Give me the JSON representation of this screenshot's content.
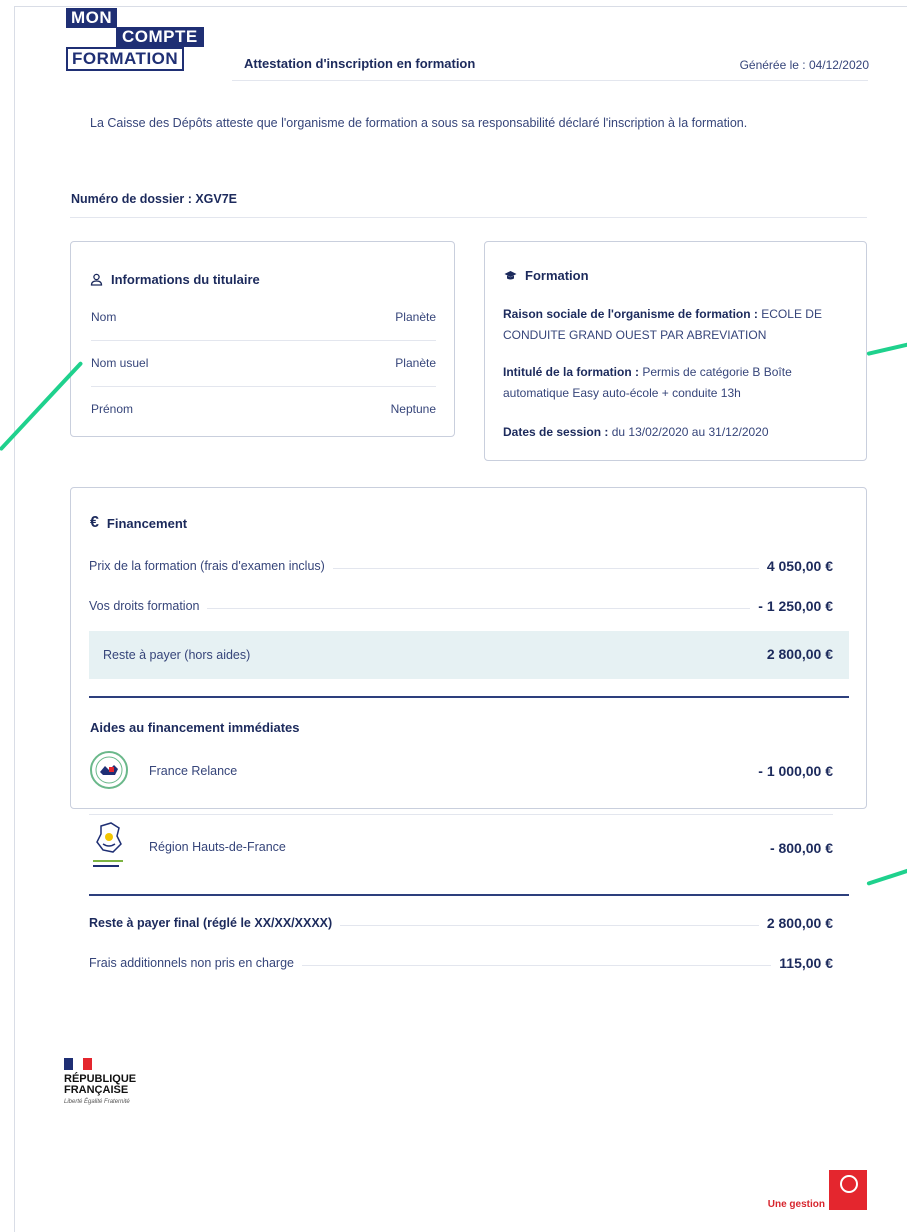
{
  "header": {
    "logo": {
      "line1": "MON",
      "line2": "COMPTE",
      "line3": "FORMATION"
    },
    "title": "Attestation d'inscription en formation",
    "generated": "Générée le : 04/12/2020"
  },
  "intro": "La Caisse des Dépôts atteste que l'organisme de formation a sous sa responsabilité déclaré l'inscription à la formation.",
  "dossier": "Numéro de dossier : XGV7E",
  "titulaire": {
    "title": "Informations du titulaire",
    "rows": [
      {
        "label": "Nom",
        "value": "Planète"
      },
      {
        "label": "Nom usuel",
        "value": "Planète"
      },
      {
        "label": "Prénom",
        "value": "Neptune"
      }
    ]
  },
  "formation": {
    "title": "Formation",
    "raison_label": "Raison sociale de l'organisme de formation :",
    "raison_value": "ECOLE DE CONDUITE GRAND OUEST PAR ABREVIATION",
    "intitule_label": "Intitulé de la formation :",
    "intitule_value": "Permis de catégorie B Boîte automatique Easy auto-école + conduite 13h",
    "dates_label": "Dates de session :",
    "dates_value": "du 13/02/2020 au 31/12/2020"
  },
  "financement": {
    "title": "Financement",
    "prix_label": "Prix de la formation (frais d'examen inclus)",
    "prix_value": "4 050,00 €",
    "droits_label": "Vos droits formation",
    "droits_value": "- 1 250,00 €",
    "reste_label": "Reste à payer (hors aides)",
    "reste_value": "2 800,00 €",
    "aides_title": "Aides au financement immédiates",
    "aides": [
      {
        "label": "France Relance",
        "value": "- 1 000,00 €",
        "icon": "france-relance-logo"
      },
      {
        "label": "Région Hauts-de-France",
        "value": "- 800,00 €",
        "icon": "region-hauts-de-france-logo"
      }
    ],
    "final_label": "Reste à payer final (réglé le XX/XX/XXXX)",
    "final_value": "2 800,00 €",
    "frais_label": "Frais additionnels non pris en charge",
    "frais_value": "115,00 €"
  },
  "footer": {
    "rf_name_1": "RÉPUBLIQUE",
    "rf_name_2": "FRANÇAISE",
    "rf_motto": "Liberté Égalité Fraternité",
    "une_gestion": "Une gestion"
  },
  "colors": {
    "navy": "#1c2a5c",
    "accent_green": "#1fd18d",
    "highlight": "#e6f1f3",
    "cdc_red": "#e4262e"
  }
}
